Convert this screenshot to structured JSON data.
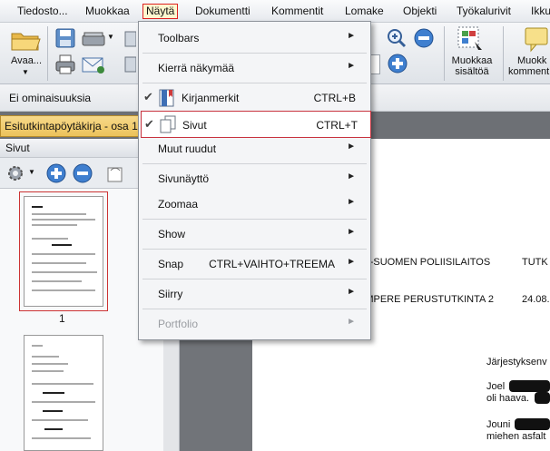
{
  "menubar": {
    "items": [
      "Tiedosto...",
      "Muokkaa",
      "Näytä",
      "Dokumentti",
      "Kommentit",
      "Lomake",
      "Objekti",
      "Työkalurivit",
      "Ikku"
    ]
  },
  "toolbar": {
    "open_label": "Avaa...",
    "edit_content_label_1": "Muokkaa",
    "edit_content_label_2": "sisältöä",
    "edit_comment_label_1": "Muokk",
    "edit_comment_label_2": "komment"
  },
  "infobar": {
    "text": "Ei ominaisuuksia"
  },
  "document_tab": {
    "title": "Esitutkintapöytäkirja - osa 1"
  },
  "side_panel": {
    "title": "Sivut",
    "selected_page_number": "1"
  },
  "document": {
    "line1_left": "ISÄ-SUOMEN POLIISILAITOS",
    "line1_right": "TUTK",
    "line2_left": "AMPERE PERUSTUTKINTA 2",
    "line2_right": "24.08.",
    "para1": "Järjestyksenv",
    "para2_a": "Joel",
    "para2_b": "oli haava.",
    "para3_a": "Jouni",
    "para3_b": "miehen asfalt"
  },
  "view_menu": {
    "items": [
      {
        "label": "Toolbars",
        "shortcut": "",
        "submenu": true,
        "checked": false,
        "disabled": false
      },
      {
        "label": "Kierrä näkymää",
        "shortcut": "",
        "submenu": true,
        "checked": false,
        "disabled": false
      },
      {
        "label": "Kirjanmerkit",
        "shortcut": "CTRL+B",
        "submenu": false,
        "checked": true,
        "disabled": false
      },
      {
        "label": "Sivut",
        "shortcut": "CTRL+T",
        "submenu": false,
        "checked": true,
        "disabled": false
      },
      {
        "label": "Muut ruudut",
        "shortcut": "",
        "submenu": true,
        "checked": false,
        "disabled": false
      },
      {
        "label": "Sivunäyttö",
        "shortcut": "",
        "submenu": true,
        "checked": false,
        "disabled": false
      },
      {
        "label": "Zoomaa",
        "shortcut": "",
        "submenu": true,
        "checked": false,
        "disabled": false
      },
      {
        "label": "Show",
        "shortcut": "",
        "submenu": true,
        "checked": false,
        "disabled": false
      },
      {
        "label": "Snap",
        "shortcut": "CTRL+VAIHTO+TREEMA",
        "submenu": true,
        "checked": false,
        "disabled": false
      },
      {
        "label": "Siirry",
        "shortcut": "",
        "submenu": true,
        "checked": false,
        "disabled": false
      },
      {
        "label": "Portfolio",
        "shortcut": "",
        "submenu": true,
        "checked": false,
        "disabled": true
      }
    ]
  },
  "colors": {
    "highlight_border": "#c8333f",
    "tab_active": "#ecc35b",
    "panel_bg": "#eef0f3"
  }
}
